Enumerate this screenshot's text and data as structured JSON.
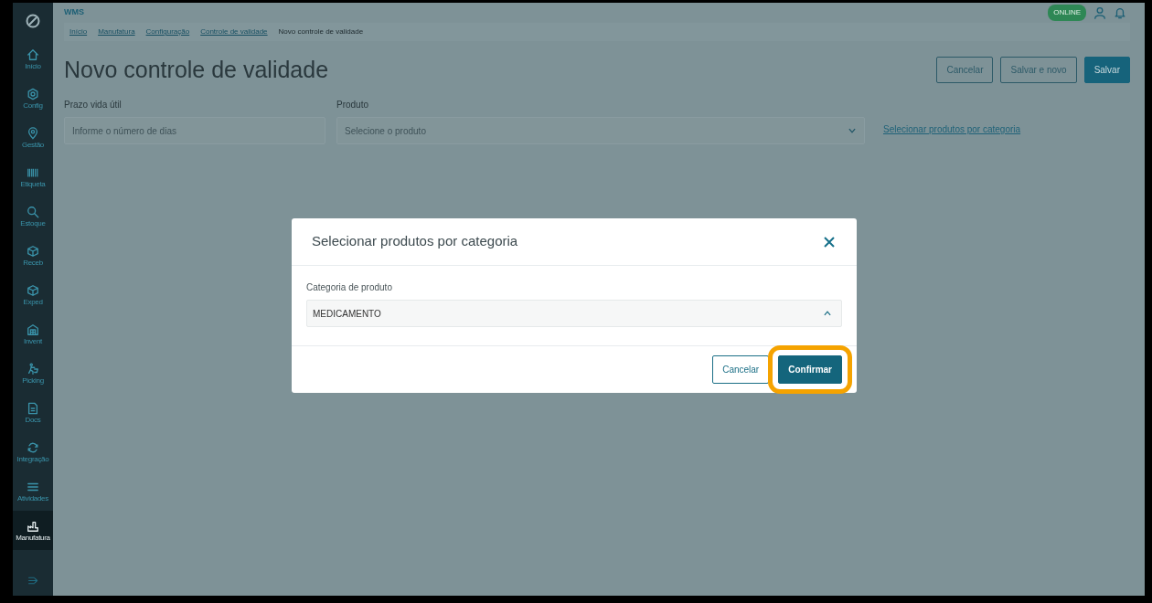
{
  "sidebar": {
    "items": [
      {
        "label": "Início",
        "selected": false
      },
      {
        "label": "Config",
        "selected": false
      },
      {
        "label": "Gestão",
        "selected": false
      },
      {
        "label": "Etiqueta",
        "selected": false
      },
      {
        "label": "Estoque",
        "selected": false
      },
      {
        "label": "Receb",
        "selected": false
      },
      {
        "label": "Exped",
        "selected": false
      },
      {
        "label": "Invent",
        "selected": false
      },
      {
        "label": "Picking",
        "selected": false
      },
      {
        "label": "Docs",
        "selected": false
      },
      {
        "label": "Integração",
        "selected": false
      },
      {
        "label": "Atividades",
        "selected": false
      },
      {
        "label": "Manufatura",
        "selected": true
      }
    ]
  },
  "topbar": {
    "app_name": "WMS",
    "status": "ONLINE"
  },
  "breadcrumb": [
    {
      "label": "Início",
      "current": false
    },
    {
      "label": "Manufatura",
      "current": false
    },
    {
      "label": "Configuração",
      "current": false
    },
    {
      "label": "Controle de validade",
      "current": false
    },
    {
      "label": "Novo controle de validade",
      "current": true
    }
  ],
  "page_title": "Novo controle de validade",
  "actions": [
    {
      "label": "Cancelar",
      "kind": "outline"
    },
    {
      "label": "Salvar e novo",
      "kind": "outline"
    },
    {
      "label": "Salvar",
      "kind": "primary"
    }
  ],
  "form": {
    "fields": [
      {
        "label": "Prazo vida útil",
        "placeholder": "Informe o número de dias",
        "kind": "input"
      },
      {
        "label": "Produto",
        "placeholder": "Selecione o produto",
        "kind": "select"
      }
    ],
    "category_link": "Selecionar produtos por categoria"
  },
  "modal": {
    "title": "Selecionar produtos por categoria",
    "field": {
      "label": "Categoria de produto",
      "value": "MEDICAMENTO",
      "expanded": true
    },
    "buttons": [
      {
        "label": "Cancelar",
        "kind": "outline",
        "highlighted": false
      },
      {
        "label": "Confirmar",
        "kind": "primary",
        "highlighted": true
      }
    ]
  }
}
